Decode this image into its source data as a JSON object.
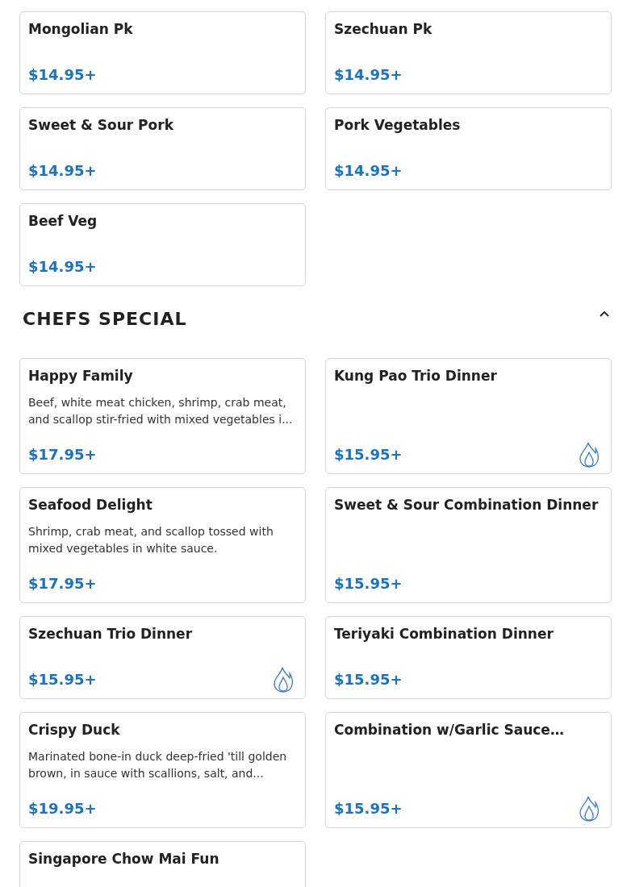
{
  "sections": [
    {
      "items": [
        {
          "name": "Mongolian Pk",
          "price": "$14.95+",
          "spicy": false
        },
        {
          "name": "Szechuan Pk",
          "price": "$14.95+",
          "spicy": false
        },
        {
          "name": "Sweet & Sour Pork",
          "price": "$14.95+",
          "spicy": false
        },
        {
          "name": "Pork Vegetables",
          "price": "$14.95+",
          "spicy": false
        },
        {
          "name": "Beef Veg",
          "price": "$14.95+",
          "spicy": false
        }
      ]
    },
    {
      "title": "CHEFS SPECIAL",
      "expanded": true,
      "items": [
        {
          "name": "Happy Family",
          "description": "Beef, white meat chicken, shrimp, crab meat, and scallop stir-fried with mixed vegetables i...",
          "price": "$17.95+",
          "spicy": false
        },
        {
          "name": "Kung Pao Trio Dinner",
          "price": "$15.95+",
          "spicy": true
        },
        {
          "name": "Seafood Delight",
          "description": "Shrimp, crab meat, and scallop tossed with mixed vegetables in white sauce.",
          "price": "$17.95+",
          "spicy": false
        },
        {
          "name": "Sweet & Sour Combination Dinner",
          "price": "$15.95+",
          "spicy": false
        },
        {
          "name": "Szechuan Trio Dinner",
          "price": "$15.95+",
          "spicy": true
        },
        {
          "name": "Teriyaki Combination Dinner",
          "price": "$15.95+",
          "spicy": false
        },
        {
          "name": "Crispy Duck",
          "description": "Marinated bone-in duck deep-fried 'till golden brown, in sauce with scallions, salt, and...",
          "price": "$19.95+",
          "spicy": false
        },
        {
          "name": "Combination w/Garlic Sauce…",
          "price": "$15.95+",
          "spicy": true
        },
        {
          "name": "Singapore Chow Mai Fun"
        }
      ]
    }
  ]
}
